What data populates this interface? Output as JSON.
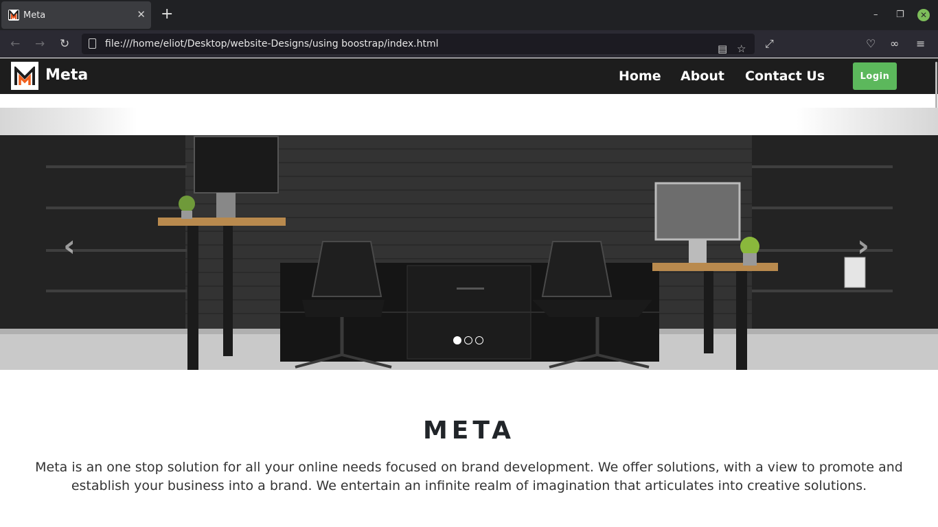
{
  "browser": {
    "tab_title": "Meta",
    "url": "file:///home/eliot/Desktop/website-Designs/using boostrap/index.html"
  },
  "site": {
    "brand": "Meta",
    "logo_letter": "M",
    "menu": [
      {
        "label": "Home"
      },
      {
        "label": "About"
      },
      {
        "label": "Contact Us"
      }
    ],
    "login_label": "Login",
    "login_color": "#5cb85c",
    "carousel": {
      "slide_count": 3,
      "active_index": 0,
      "prev_icon": "chevron-left-icon",
      "next_icon": "chevron-right-icon"
    },
    "heading": "META",
    "description": "Meta is an one stop solution for all your online needs focused on brand development. We offer solutions, with a view to promote and establish your business into a brand. We entertain an infinite realm of imagination that articulates into creative solutions."
  }
}
